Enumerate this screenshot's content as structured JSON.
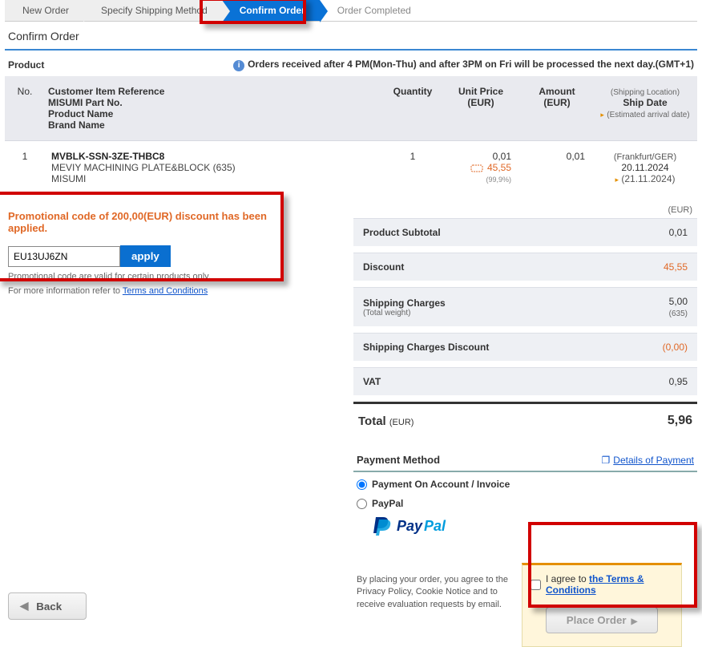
{
  "stepper": {
    "s1": "New Order",
    "s2": "Specify Shipping Method",
    "s3": "Confirm Order",
    "s4": "Order Completed"
  },
  "page_title": "Confirm Order",
  "product_section_label": "Product",
  "notice": "Orders received after 4 PM(Mon-Thu) and after 3PM on Fri will be processed the next day.(GMT+1)",
  "headers": {
    "no": "No.",
    "desc": {
      "l1": "Customer Item Reference",
      "l2": "MISUMI Part No.",
      "l3": "Product Name",
      "l4": "Brand Name"
    },
    "qty": "Quantity",
    "unit_price": "Unit Price",
    "unit_price_cur": "(EUR)",
    "amount": "Amount",
    "amount_cur": "(EUR)",
    "ship_loc": "(Shipping Location)",
    "ship_date": "Ship Date",
    "ship_est": "(Estimated arrival date)"
  },
  "row": {
    "no": "1",
    "part_no": "MVBLK-SSN-3ZE-THBC8",
    "name": "MEVIY MACHINING PLATE&BLOCK  (635)",
    "brand": "MISUMI",
    "qty": "1",
    "unit_price": "0,01",
    "unit_disc": "45,55",
    "coupon_label": "coupon",
    "disc_pct": "(99,9%)",
    "amount": "0,01",
    "ship_loc": "(Frankfurt/GER)",
    "ship_date": "20.11.2024",
    "ship_est": "(21.11.2024)"
  },
  "promo": {
    "msg": "Promotional code of 200,00(EUR) discount has been applied.",
    "code": "EU13UJ6ZN",
    "apply": "apply",
    "note1": "Promotional code are valid for certain products only.",
    "note2_prefix": "For more information refer to ",
    "note2_link": "Terms and Conditions"
  },
  "totals": {
    "currency": "(EUR)",
    "subtotal_label": "Product Subtotal",
    "subtotal": "0,01",
    "discount_label": "Discount",
    "discount": "45,55",
    "shipping_label": "Shipping Charges",
    "shipping_sub": "(Total weight)",
    "shipping": "5,00",
    "shipping_weight": "(635)",
    "shipping_disc_label": "Shipping Charges Discount",
    "shipping_disc": "(0,00)",
    "vat_label": "VAT",
    "vat": "0,95",
    "total_label": "Total",
    "total_cur": "(EUR)",
    "total": "5,96"
  },
  "payment": {
    "title": "Payment Method",
    "details_link": "Details of Payment",
    "opt1": "Payment On Account / Invoice",
    "opt2": "PayPal"
  },
  "footer": {
    "note": "By placing your order, you agree to the Privacy Policy, Cookie Notice and to receive evaluation requests by email.",
    "agree_prefix": "I agree to ",
    "agree_link": "the Terms & Conditions",
    "place_order": "Place Order",
    "back": "Back"
  }
}
